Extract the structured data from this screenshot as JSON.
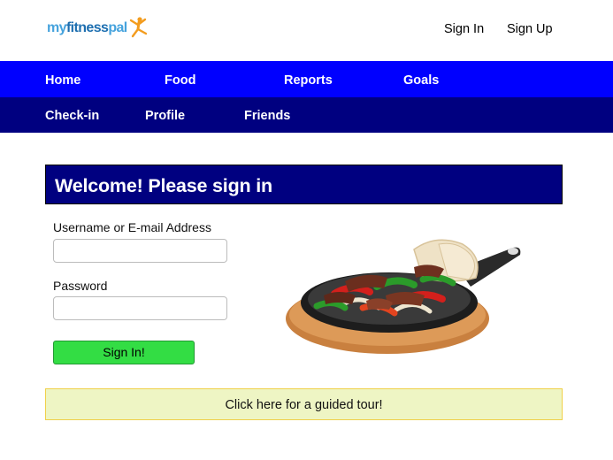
{
  "header": {
    "logo": {
      "part_my": "my",
      "part_fitness": "fitness",
      "part_pal": "pal",
      "icon": "jumping-person-icon"
    },
    "signin_label": "Sign In",
    "signup_label": "Sign Up"
  },
  "nav": {
    "primary": [
      "Home",
      "Food",
      "Reports",
      "Goals"
    ],
    "secondary": [
      "Check-in",
      "Profile",
      "Friends"
    ],
    "primary_color": "#0000ff",
    "secondary_color": "#000080"
  },
  "login": {
    "title": "Welcome! Please sign in",
    "username_label": "Username or E-mail Address",
    "username_value": "",
    "password_label": "Password",
    "password_value": "",
    "submit_label": "Sign In!",
    "submit_color": "#33dd44"
  },
  "hero": {
    "icon": "fajitas-skillet-image"
  },
  "tour": {
    "label": "Click here for a guided tour!",
    "background": "#eef5c4"
  }
}
